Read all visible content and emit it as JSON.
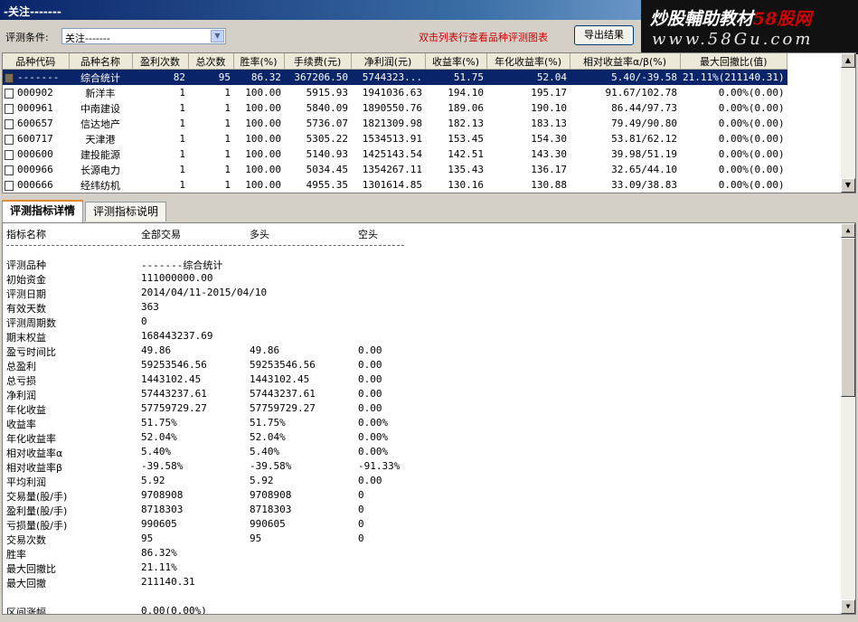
{
  "window": {
    "title": "-关注-------"
  },
  "watermark": {
    "line1_a": "炒股輔助教材",
    "line1_b": "58股网",
    "line2": "www.58Gu.com"
  },
  "toolbar": {
    "condition_label": "评测条件:",
    "condition_value": "关注-------",
    "hint": "双击列表行查看品种评测图表",
    "export_label": "导出结果"
  },
  "grid": {
    "columns": [
      "品种代码",
      "品种名称",
      "盈利次数",
      "总次数",
      "胜率(%)",
      "手续费(元)",
      "净利润(元)",
      "收益率(%)",
      "年化收益率(%)",
      "相对收益率α/β(%)",
      "最大回撤比(值)"
    ],
    "rows": [
      [
        "-------",
        "综合统计",
        "82",
        "95",
        "86.32",
        "367206.50",
        "5744323...",
        "51.75",
        "52.04",
        "5.40/-39.58",
        "21.11%(211140.31)"
      ],
      [
        "000902",
        "新洋丰",
        "1",
        "1",
        "100.00",
        "5915.93",
        "1941036.63",
        "194.10",
        "195.17",
        "91.67/102.78",
        "0.00%(0.00)"
      ],
      [
        "000961",
        "中南建设",
        "1",
        "1",
        "100.00",
        "5840.09",
        "1890550.76",
        "189.06",
        "190.10",
        "86.44/97.73",
        "0.00%(0.00)"
      ],
      [
        "600657",
        "信达地产",
        "1",
        "1",
        "100.00",
        "5736.07",
        "1821309.98",
        "182.13",
        "183.13",
        "79.49/90.80",
        "0.00%(0.00)"
      ],
      [
        "600717",
        "天津港",
        "1",
        "1",
        "100.00",
        "5305.22",
        "1534513.91",
        "153.45",
        "154.30",
        "53.81/62.12",
        "0.00%(0.00)"
      ],
      [
        "000600",
        "建投能源",
        "1",
        "1",
        "100.00",
        "5140.93",
        "1425143.54",
        "142.51",
        "143.30",
        "39.98/51.19",
        "0.00%(0.00)"
      ],
      [
        "000966",
        "长源电力",
        "1",
        "1",
        "100.00",
        "5034.45",
        "1354267.11",
        "135.43",
        "136.17",
        "32.65/44.10",
        "0.00%(0.00)"
      ],
      [
        "000666",
        "经纬纺机",
        "1",
        "1",
        "100.00",
        "4955.35",
        "1301614.85",
        "130.16",
        "130.88",
        "33.09/38.83",
        "0.00%(0.00)"
      ]
    ]
  },
  "tabs": [
    {
      "label": "评测指标详情"
    },
    {
      "label": "评测指标说明"
    }
  ],
  "detail": {
    "header": [
      "指标名称",
      "全部交易",
      "多头",
      "空头"
    ],
    "rows": [
      [
        "评测品种",
        "-------综合统计",
        "",
        ""
      ],
      [
        "初始资金",
        "111000000.00",
        "",
        ""
      ],
      [
        "评测日期",
        "2014/04/11-2015/04/10",
        "",
        ""
      ],
      [
        "有效天数",
        "363",
        "",
        ""
      ],
      [
        "评测周期数",
        "0",
        "",
        ""
      ],
      [
        "期末权益",
        "168443237.69",
        "",
        ""
      ],
      [
        "盈亏时间比",
        "49.86",
        "49.86",
        "0.00"
      ],
      [
        "总盈利",
        "59253546.56",
        "59253546.56",
        "0.00"
      ],
      [
        "总亏损",
        "1443102.45",
        "1443102.45",
        "0.00"
      ],
      [
        "净利润",
        "57443237.61",
        "57443237.61",
        "0.00"
      ],
      [
        "年化收益",
        "57759729.27",
        "57759729.27",
        "0.00"
      ],
      [
        "收益率",
        "51.75%",
        "51.75%",
        "0.00%"
      ],
      [
        "年化收益率",
        "52.04%",
        "52.04%",
        "0.00%"
      ],
      [
        "相对收益率α",
        "5.40%",
        " 5.40%",
        "  0.00%"
      ],
      [
        "相对收益率β",
        "-39.58%",
        "  -39.58%",
        "   -91.33%"
      ],
      [
        "平均利润",
        "5.92",
        "5.92",
        "0.00"
      ],
      [
        "交易量(股/手)",
        "9708908",
        "9708908",
        "0"
      ],
      [
        "盈利量(股/手)",
        "8718303",
        "8718303",
        "0"
      ],
      [
        "亏损量(股/手)",
        "990605",
        "990605",
        "0"
      ],
      [
        "交易次数",
        "95",
        "95",
        "0"
      ],
      [
        "胜率",
        "86.32%",
        "",
        ""
      ],
      [
        "最大回撤比",
        "21.11%",
        "",
        ""
      ],
      [
        "最大回撤",
        "211140.31",
        "",
        ""
      ],
      [
        "",
        "",
        "",
        ""
      ],
      [
        "区间涨幅",
        "0.00(0.00%)",
        "",
        ""
      ]
    ]
  }
}
